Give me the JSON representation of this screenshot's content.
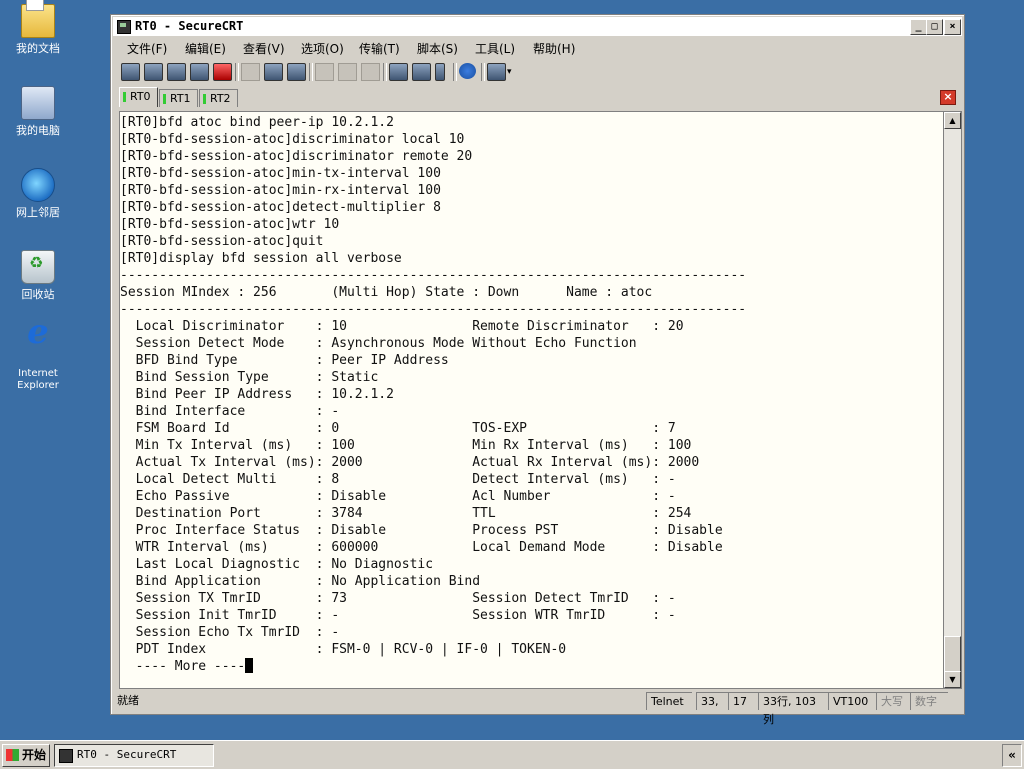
{
  "desktop": {
    "icons": [
      {
        "label": "我的文档",
        "icon": "my-documents-icon"
      },
      {
        "label": "我的电脑",
        "icon": "my-computer-icon"
      },
      {
        "label": "网上邻居",
        "icon": "network-places-icon"
      },
      {
        "label": "回收站",
        "icon": "recycle-bin-icon"
      },
      {
        "label": "Internet Explorer",
        "icon": "internet-explorer-icon"
      }
    ]
  },
  "window": {
    "title": "RT0 - SecureCRT",
    "controls": {
      "minimize": "_",
      "maximize": "□",
      "close": "×"
    },
    "menu": [
      "文件(F)",
      "编辑(E)",
      "查看(V)",
      "选项(O)",
      "传输(T)",
      "脚本(S)",
      "工具(L)",
      "帮助(H)"
    ],
    "tabs": [
      {
        "label": "RT0",
        "active": true
      },
      {
        "label": "RT1",
        "active": false
      },
      {
        "label": "RT2",
        "active": false
      }
    ],
    "tab_close": "×",
    "terminal": {
      "lines": [
        "[RT0]bfd atoc bind peer-ip 10.2.1.2",
        "[RT0-bfd-session-atoc]discriminator local 10",
        "[RT0-bfd-session-atoc]discriminator remote 20",
        "[RT0-bfd-session-atoc]min-tx-interval 100",
        "[RT0-bfd-session-atoc]min-rx-interval 100",
        "[RT0-bfd-session-atoc]detect-multiplier 8",
        "[RT0-bfd-session-atoc]wtr 10",
        "[RT0-bfd-session-atoc]quit",
        "[RT0]display bfd session all verbose",
        "--------------------------------------------------------------------------------",
        "Session MIndex : 256       (Multi Hop) State : Down      Name : atoc",
        "--------------------------------------------------------------------------------",
        "  Local Discriminator    : 10                Remote Discriminator   : 20",
        "  Session Detect Mode    : Asynchronous Mode Without Echo Function",
        "  BFD Bind Type          : Peer IP Address",
        "  Bind Session Type      : Static",
        "  Bind Peer IP Address   : 10.2.1.2",
        "  Bind Interface         : -",
        "  FSM Board Id           : 0                 TOS-EXP                : 7",
        "  Min Tx Interval (ms)   : 100               Min Rx Interval (ms)   : 100",
        "  Actual Tx Interval (ms): 2000              Actual Rx Interval (ms): 2000",
        "  Local Detect Multi     : 8                 Detect Interval (ms)   : -",
        "  Echo Passive           : Disable           Acl Number             : -",
        "  Destination Port       : 3784              TTL                    : 254",
        "  Proc Interface Status  : Disable           Process PST            : Disable",
        "  WTR Interval (ms)      : 600000            Local Demand Mode      : Disable",
        "  Last Local Diagnostic  : No Diagnostic",
        "  Bind Application       : No Application Bind",
        "  Session TX TmrID       : 73                Session Detect TmrID   : -",
        "  Session Init TmrID     : -                 Session WTR TmrID      : -",
        "  Session Echo Tx TmrID  : -",
        "  PDT Index              : FSM-0 | RCV-0 | IF-0 | TOKEN-0",
        "  ---- More ----"
      ]
    },
    "statusbar": {
      "ready": "就绪",
      "protocol": "Telnet",
      "row": "33,",
      "col": "17",
      "size": "33行, 103列",
      "emulation": "VT100",
      "caps": "大写",
      "num": "数字"
    }
  },
  "taskbar": {
    "start": "开始",
    "task": "RT0 - SecureCRT",
    "tray": "«"
  }
}
